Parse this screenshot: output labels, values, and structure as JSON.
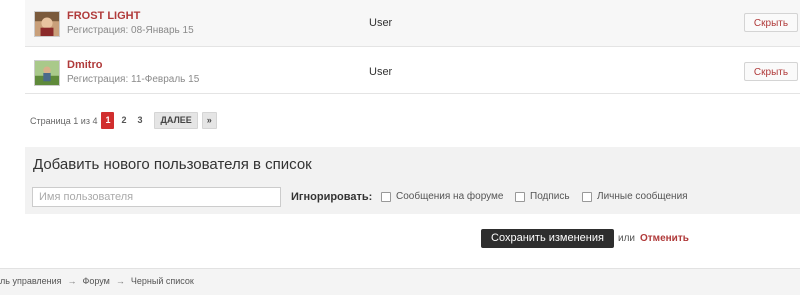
{
  "users": [
    {
      "name": "FROST LIGHT",
      "registration": "Регистрация: 08-Январь 15",
      "group": "User",
      "hide_label": "Скрыть"
    },
    {
      "name": "Dmitro",
      "registration": "Регистрация: 11-Февраль 15",
      "group": "User",
      "hide_label": "Скрыть"
    }
  ],
  "pagination": {
    "info": "Страница 1 из 4",
    "pages": [
      "1",
      "2",
      "3"
    ],
    "current": "1",
    "next_label": "ДАЛЕЕ",
    "last_label": "»"
  },
  "add_user": {
    "title": "Добавить нового пользователя в список",
    "username_placeholder": "Имя пользователя",
    "ignore_label": "Игнорировать:",
    "options": [
      "Сообщения на форуме",
      "Подпись",
      "Личные сообщения"
    ]
  },
  "actions": {
    "save_label": "Сохранить изменения",
    "or_text": "или",
    "cancel_label": "Отменить"
  },
  "breadcrumb": {
    "items": [
      "ль управления",
      "Форум",
      "Черный список"
    ],
    "separator": "→"
  },
  "colors": {
    "accent": "#b03a3a",
    "current_page": "#d12e2e",
    "save_button": "#2e2e2e"
  }
}
